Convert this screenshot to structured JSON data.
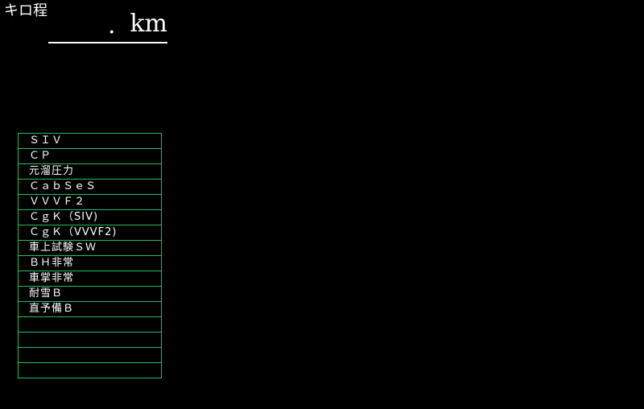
{
  "kilo": {
    "label": "キロ程",
    "value_dot": ".",
    "unit": "km"
  },
  "status_items": [
    "ＳＩＶ",
    "ＣＰ",
    "元溜圧力",
    "ＣａｂＳｅＳ",
    "ＶＶＶＦ２",
    "ＣｇＫ（SIV)",
    "ＣｇＫ（VVVF2)",
    "車上試験ＳＷ",
    "ＢＨ非常",
    "車掌非常",
    "耐雪Ｂ",
    "直予備Ｂ",
    "",
    "",
    "",
    ""
  ],
  "colors": {
    "background": "#000000",
    "text": "#ffffff",
    "grid": "#22c05a"
  }
}
